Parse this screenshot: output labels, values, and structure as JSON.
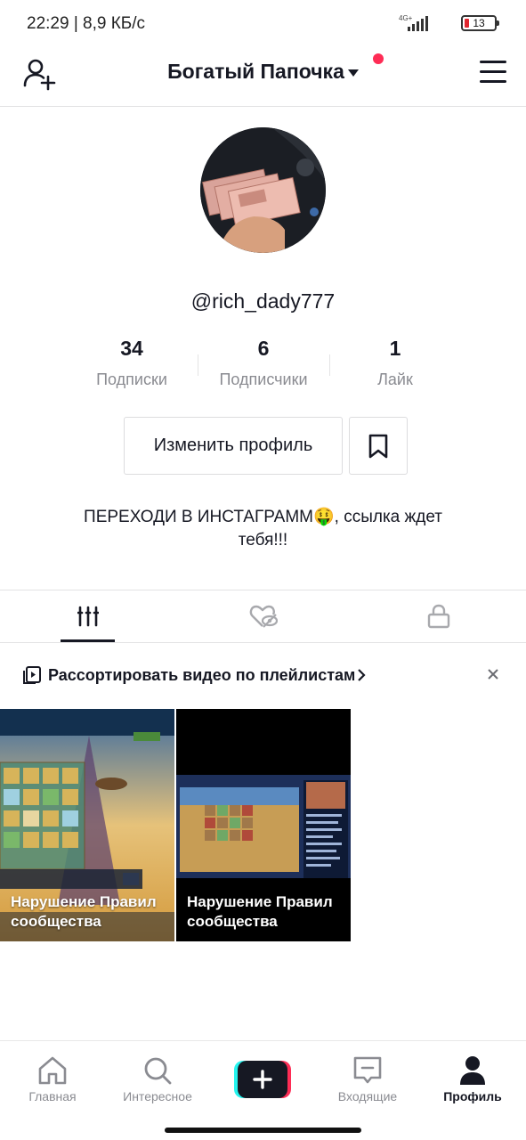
{
  "status_bar": {
    "time": "22:29",
    "speed": "8,9 КБ/с",
    "network": "4G+",
    "battery": "13"
  },
  "header": {
    "title": "Богатый Папочка",
    "notification_color": "#fe2c55"
  },
  "profile": {
    "username": "@rich_dady777",
    "stats": [
      {
        "value": "34",
        "label": "Подписки"
      },
      {
        "value": "6",
        "label": "Подписчики"
      },
      {
        "value": "1",
        "label": "Лайк"
      }
    ],
    "edit_label": "Изменить профиль",
    "bio_line1": "ПЕРЕХОДИ В ИНСТАГРАММ🤑, ссылка ждет",
    "bio_line2": "тебя!!!"
  },
  "tabs": {
    "icons": [
      "videos-grid-icon",
      "liked-hidden-icon",
      "lock-icon"
    ],
    "active_index": 0
  },
  "playlist_banner": {
    "text": "Рассортировать видео по плейлистам"
  },
  "videos": [
    {
      "caption_line1": "Нарушение Правил",
      "caption_line2": "сообщества"
    },
    {
      "caption_line1": "Нарушение Правил",
      "caption_line2": "сообщества"
    }
  ],
  "bottom_nav": {
    "items": [
      {
        "label": "Главная",
        "icon": "home-icon"
      },
      {
        "label": "Интересное",
        "icon": "search-icon"
      },
      {
        "label": "",
        "icon": "create-icon"
      },
      {
        "label": "Входящие",
        "icon": "inbox-icon"
      },
      {
        "label": "Профиль",
        "icon": "profile-icon"
      }
    ],
    "active_index": 4
  },
  "colors": {
    "accent_red": "#fe2c55",
    "accent_cyan": "#25f4ee",
    "text": "#161823",
    "muted": "#8a8b91"
  }
}
